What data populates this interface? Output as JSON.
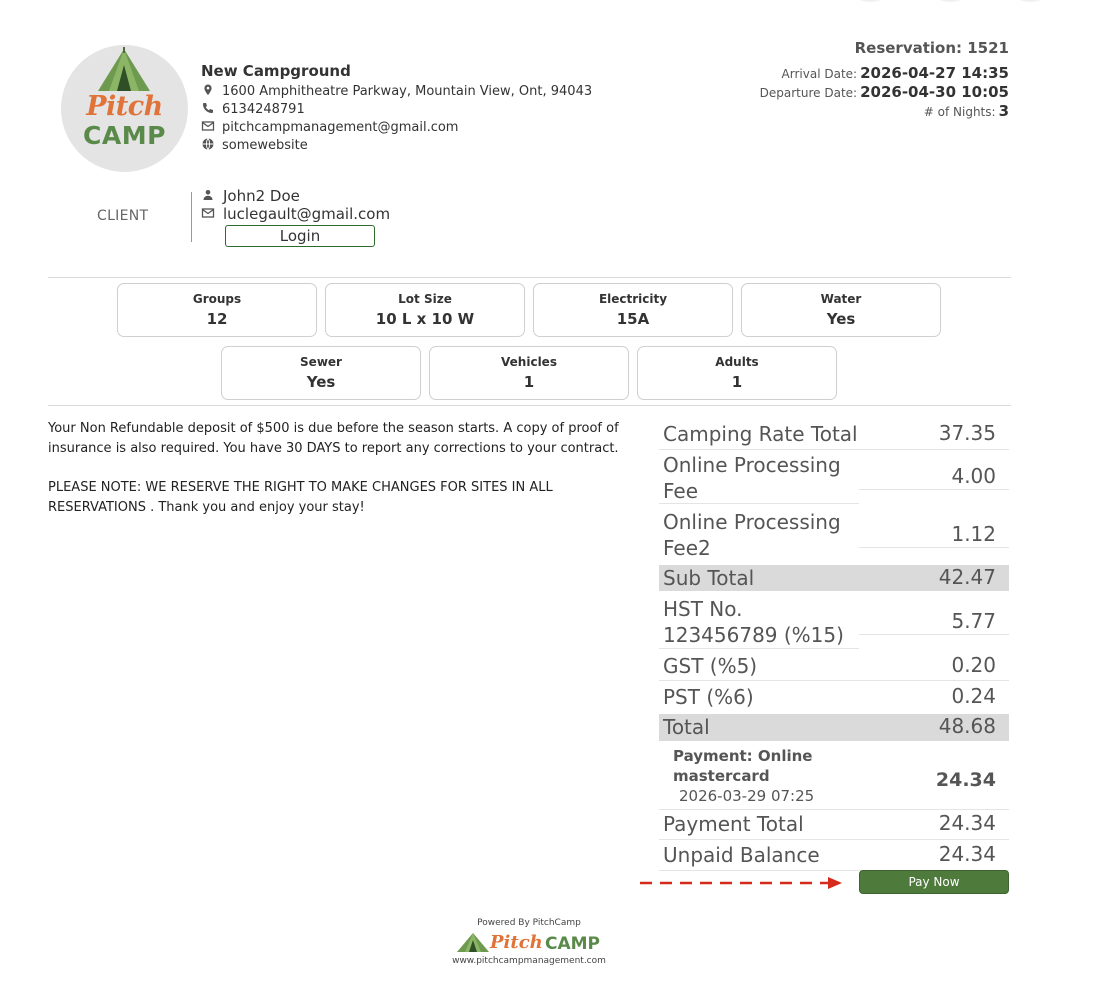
{
  "campground": {
    "logo_text_top": "Pitch",
    "logo_text_bottom": "CAMP",
    "name": "New Campground",
    "address": "1600 Amphitheatre Parkway, Mountain View, Ont, 94043",
    "phone": "6134248791",
    "email": "pitchcampmanagement@gmail.com",
    "website": "somewebsite",
    "icons": [
      "location-pin-icon",
      "phone-icon",
      "mail-icon",
      "globe-icon"
    ]
  },
  "reservation": {
    "title": "Reservation: 1521",
    "arrival_label": "Arrival Date:",
    "arrival_value": "2026-04-27 14:35",
    "departure_label": "Departure Date:",
    "departure_value": "2026-04-30 10:05",
    "nights_label": "# of Nights:",
    "nights_value": "3"
  },
  "client": {
    "label": "CLIENT",
    "name": "John2 Doe",
    "email": "luclegault@gmail.com",
    "login_label": "Login"
  },
  "specs": [
    {
      "label": "Groups",
      "value": "12"
    },
    {
      "label": "Lot Size",
      "value": "10 L x 10 W"
    },
    {
      "label": "Electricity",
      "value": "15A"
    },
    {
      "label": "Water",
      "value": "Yes"
    },
    {
      "label": "Sewer",
      "value": "Yes"
    },
    {
      "label": "Vehicles",
      "value": "1"
    },
    {
      "label": "Adults",
      "value": "1"
    }
  ],
  "notes": {
    "paragraph1": "Your Non Refundable deposit of $500 is due before the season starts. A copy of proof of insurance is also required. You have 30 DAYS to report any corrections to your contract.",
    "paragraph2": "PLEASE NOTE: WE RESERVE THE RIGHT TO MAKE CHANGES FOR SITES IN ALL RESERVATIONS . Thank you and enjoy your stay!"
  },
  "totals": {
    "camping_rate_label": "Camping Rate Total",
    "camping_rate_value": "37.35",
    "fee1_label": "Online Processing Fee",
    "fee1_value": "4.00",
    "fee2_label": "Online Processing Fee2",
    "fee2_value": "1.12",
    "subtotal_label": "Sub Total",
    "subtotal_value": "42.47",
    "hst_label": "HST No. 123456789 (%15)",
    "hst_value": "5.77",
    "gst_label": "GST (%5)",
    "gst_value": "0.20",
    "pst_label": "PST (%6)",
    "pst_value": "0.24",
    "total_label": "Total",
    "total_value": "48.68",
    "payment_label": "Payment: Online mastercard",
    "payment_date": "2026-03-29 07:25",
    "payment_value": "24.34",
    "payment_total_label": "Payment Total",
    "payment_total_value": "24.34",
    "unpaid_label": "Unpaid Balance",
    "unpaid_value": "24.34"
  },
  "actions": {
    "pay_now_label": "Pay Now"
  },
  "footer": {
    "powered_by": "Powered By PitchCamp",
    "logo_pitch": "Pitch",
    "logo_camp": "CAMP",
    "url": "www.pitchcampmanagement.com"
  },
  "colors": {
    "brand_orange": "#e0733a",
    "brand_green": "#5a8a4a",
    "pay_button": "#4e7a3c",
    "arrow_red": "#d62a1a",
    "shaded_row": "#dadada"
  }
}
